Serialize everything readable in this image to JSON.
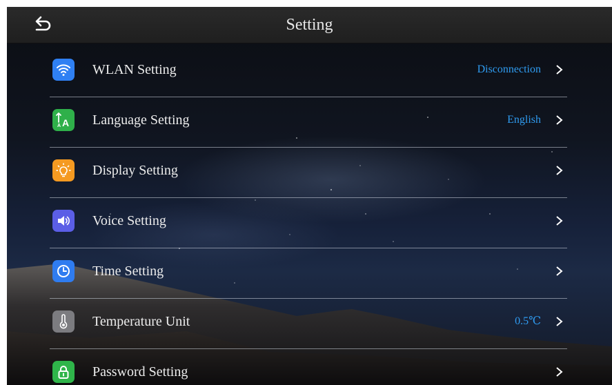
{
  "header": {
    "title": "Setting",
    "back_icon": "back-arrow-icon"
  },
  "settings": [
    {
      "label": "WLAN Setting",
      "value": "Disconnection",
      "icon": "wifi-icon",
      "color": "#2f80f3"
    },
    {
      "label": "Language Setting",
      "value": "English",
      "icon": "language-icon",
      "color": "#2fb04a"
    },
    {
      "label": "Display Setting",
      "value": "",
      "icon": "lightbulb-icon",
      "color": "#f59a21"
    },
    {
      "label": "Voice Setting",
      "value": "",
      "icon": "speaker-icon",
      "color": "#5b5ee6"
    },
    {
      "label": "Time Setting",
      "value": "",
      "icon": "clock-icon",
      "color": "#2f7cf0"
    },
    {
      "label": "Temperature Unit",
      "value": "0.5℃",
      "icon": "thermometer-icon",
      "color": "#7c7c80"
    },
    {
      "label": "Password Setting",
      "value": "",
      "icon": "lock-icon",
      "color": "#2fb54a"
    }
  ],
  "colors": {
    "value_text": "#2f9bf0",
    "label_text": "#ececec",
    "header_bg": "#242424"
  }
}
